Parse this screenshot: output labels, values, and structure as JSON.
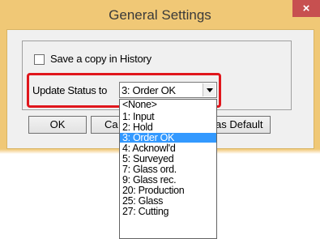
{
  "window": {
    "title": "General Settings",
    "close_symbol": "×"
  },
  "history_checkbox": {
    "label": "Save a copy in History",
    "checked": false
  },
  "update_status": {
    "label": "Update Status to",
    "selected_value": "3: Order OK"
  },
  "buttons": {
    "ok": "OK",
    "cancel_partial": "Ca",
    "default_partial": "as Default"
  },
  "dropdown": {
    "items": [
      "<None>",
      "1: Input",
      "2: Hold",
      "3: Order OK",
      "4: Acknowl'd",
      "5: Surveyed",
      "7: Glass ord.",
      "9: Glass rec.",
      "20: Production",
      "25: Glass",
      "27: Cutting"
    ],
    "selected_index": 3
  },
  "colors": {
    "title_bar": "#f0c876",
    "close_button": "#c75050",
    "highlight": "#e0161c",
    "selection": "#3399ff"
  }
}
